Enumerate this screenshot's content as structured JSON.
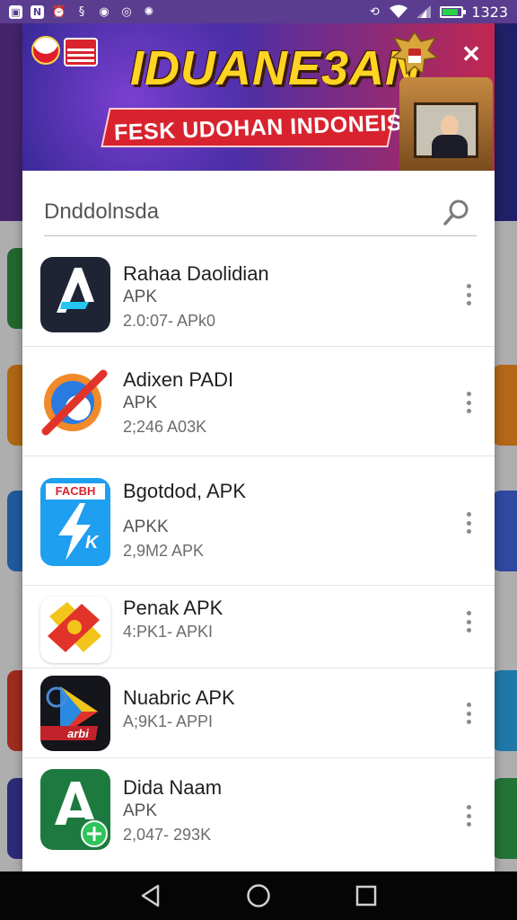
{
  "status_bar": {
    "time": "1323",
    "left_icons": [
      "image-icon",
      "news-icon",
      "alarm-icon",
      "sync-icon",
      "media-icon",
      "instagram-icon",
      "settings-icon"
    ],
    "right_icons": [
      "rotation-icon",
      "wifi-icon",
      "signal-icon",
      "battery-icon"
    ],
    "battery_level": 0.85
  },
  "banner": {
    "title": "IDUANE3AN",
    "subtitle": "FESK UDOHAN INDONEISA",
    "close_label": "✕",
    "colors": {
      "title": "#ffd423",
      "subtitle_bg": "#d8232f",
      "gradient_start": "#3b2a9a",
      "gradient_end": "#c2274f"
    }
  },
  "search": {
    "value": "Dnddolnsda",
    "placeholder": ""
  },
  "apps": [
    {
      "name": "Rahaa Daolidian",
      "type": "APK",
      "meta": "2.0:07- APk0",
      "icon": "app-icon-a"
    },
    {
      "name": "Adixen PADI",
      "type": "APK",
      "meta": "2;246 A03K",
      "icon": "app-icon-circle-slash"
    },
    {
      "name": "Bgotdod, APK",
      "type": "APKK",
      "meta": "2,9M2 APK",
      "icon": "app-icon-lightning",
      "icon_label": "FACBH"
    },
    {
      "name": "Penak APK",
      "type": "",
      "meta": "4:PK1- APKI",
      "icon": "app-icon-cross"
    },
    {
      "name": "Nuabric APK",
      "type": "",
      "meta": "A;9K1- APPI",
      "icon": "app-icon-play",
      "icon_label": "arbi"
    },
    {
      "name": "Dida Naam",
      "type": "APK",
      "meta": "2,047- 293K",
      "icon": "app-icon-a-green"
    }
  ],
  "nav_bar": {
    "buttons": [
      "back-icon",
      "home-icon",
      "recents-icon"
    ]
  }
}
